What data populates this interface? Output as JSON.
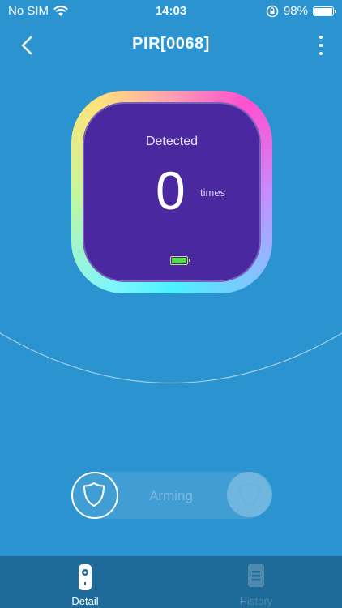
{
  "status": {
    "carrier": "No SIM",
    "time": "14:03",
    "battery_percent": "98%",
    "battery_level": 0.98
  },
  "nav": {
    "title": "PIR[0068]",
    "back_icon": "chevron-left-icon",
    "more_icon": "more-vertical-icon"
  },
  "gauge": {
    "label": "Detected",
    "count": "0",
    "unit": "times",
    "battery_icon": "battery-icon",
    "battery_level": 0.95
  },
  "arming": {
    "label": "Arming",
    "left_icon": "shield-icon",
    "right_icon": "shield-icon"
  },
  "tabs": [
    {
      "label": "Detail",
      "icon": "remote-icon",
      "active": true
    },
    {
      "label": "History",
      "icon": "document-icon",
      "active": false
    }
  ],
  "colors": {
    "background": "#2b94d0",
    "panel": "#4a28a0",
    "tabbar": "#1e6b99",
    "inactive_tab": "#4f89ad"
  }
}
